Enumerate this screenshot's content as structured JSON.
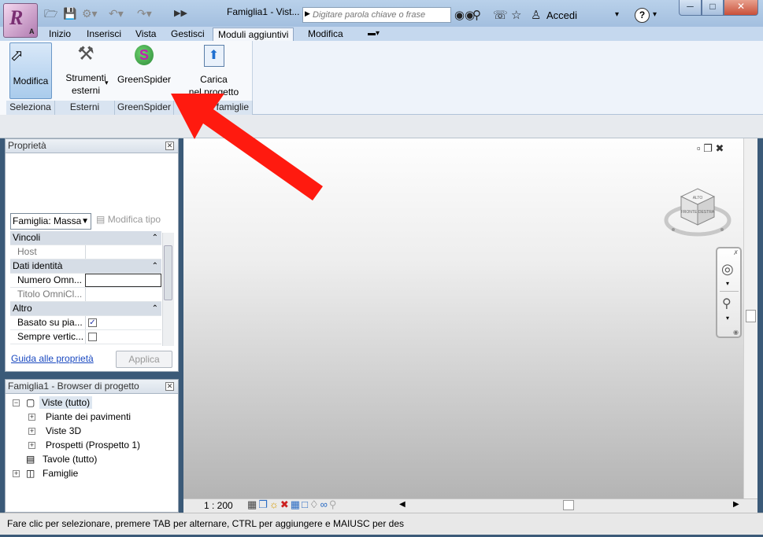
{
  "window": {
    "doc_title": "Famiglia1 - Vist...",
    "search_placeholder": "Digitare parola chiave o frase",
    "signin": "Accedi",
    "help": "?",
    "app_letter": "R",
    "app_sub": "A"
  },
  "tabs": [
    "Inizio",
    "Inserisci",
    "Vista",
    "Gestisci",
    "Moduli aggiuntivi",
    "Modifica"
  ],
  "ribbon": {
    "buttons": {
      "modifica": "Modifica",
      "strumenti_1": "Strumenti",
      "strumenti_2": "esterni",
      "greenspider": "GreenSpider",
      "carica_1": "Carica",
      "carica_2": "nel progetto"
    },
    "panels": [
      "Seleziona",
      "Esterni",
      "GreenSpider",
      "famiglie"
    ]
  },
  "properties": {
    "title": "Proprietà",
    "family_select": "Famiglia: Massa",
    "edit_type": "Modifica tipo",
    "categories": {
      "vincoli": "Vincoli",
      "dati_identita": "Dati identità",
      "altro": "Altro"
    },
    "params": {
      "host": "Host",
      "numero_omni": "Numero Omn...",
      "titolo_omni": "Titolo OmniCl...",
      "basato": "Basato su pia...",
      "sempre": "Sempre vertic..."
    },
    "checks": {
      "basato": true,
      "sempre": false
    },
    "help_link": "Guida alle proprietà",
    "apply": "Applica"
  },
  "browser": {
    "title": "Famiglia1 - Browser di progetto",
    "items": {
      "viste": "Viste (tutto)",
      "piante": "Piante dei pavimenti",
      "viste3d": "Viste 3D",
      "prospetti": "Prospetti (Prospetto 1)",
      "tavole": "Tavole (tutto)",
      "famiglie": "Famiglie"
    }
  },
  "view": {
    "scale": "1 : 200",
    "viewcube_faces": [
      "ALTO",
      "FRONTE",
      "DESTRA"
    ]
  },
  "status": "Fare clic per selezionare, premere TAB per alternare, CTRL per aggiungere e MAIUSC per des",
  "colors": {
    "arrow": "#ff1a0f",
    "accent": "#a9cbec",
    "greenspider": "#32a852"
  }
}
